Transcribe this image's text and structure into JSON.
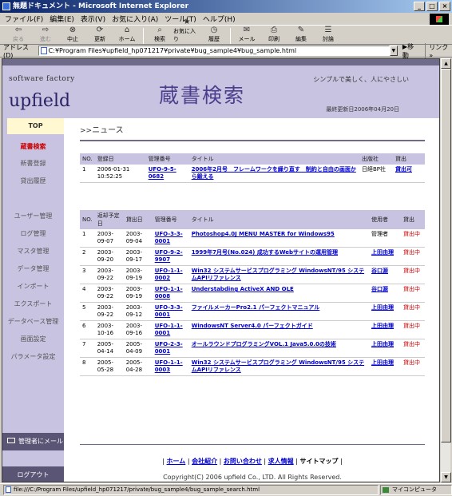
{
  "window": {
    "title": "無題ドキュメント - Microsoft Internet Explorer",
    "minimize": "_",
    "maximize": "□",
    "close": "×"
  },
  "menu": [
    "ファイル(F)",
    "編集(E)",
    "表示(V)",
    "お気に入り(A)",
    "ツール(T)",
    "ヘルプ(H)"
  ],
  "toolbar": {
    "back": "戻る",
    "forward": "進む",
    "stop": "中止",
    "refresh": "更新",
    "home": "ホーム",
    "search": "検索",
    "favorites": "お気に入り",
    "history": "履歴",
    "mail": "メール",
    "print": "印刷",
    "edit": "編集",
    "discuss": "討論"
  },
  "address": {
    "label": "アドレス(D)",
    "value": "C:¥Program Files¥upfield_hp071217¥private¥bug_sample4¥bug_sample.html",
    "go": "移動",
    "links": "リンク »"
  },
  "header": {
    "company": "software factory",
    "logo": "upfield",
    "title": "蔵書検索",
    "tagline": "シンプルで美しく、人にやさしい",
    "updated": "最終更新日2006年04月20日"
  },
  "sidebar": {
    "top": "TOP",
    "items": [
      "蔵書検索",
      "新書登録",
      "貸出履歴",
      "ユーザー管理",
      "ログ管理",
      "マスタ管理",
      "データ管理",
      "インポート",
      "エクスポート",
      "データベース管理",
      "画面設定",
      "パラメータ設定"
    ],
    "mail": "管理者にメール",
    "logout": "ログアウト"
  },
  "news": {
    "heading_arrows": ">>",
    "heading": "ニュース",
    "columns": [
      "NO.",
      "登録日",
      "管理番号",
      "タイトル",
      "出版社",
      "貸出"
    ],
    "rows": [
      {
        "no": "1",
        "date": "2006-01-31 10:52:25",
        "id": "UFO-9-5-0682",
        "title": "2006年2月号　フレームワークを繰り直す　制約と自由の画面から鍛える",
        "publisher": "日経BP社",
        "status": "貸出可"
      }
    ]
  },
  "loans": {
    "columns": [
      "NO.",
      "返却予定日",
      "貸出日",
      "管理番号",
      "タイトル",
      "使用者",
      "貸出"
    ],
    "rows": [
      {
        "no": "1",
        "due": "2003-09-07",
        "lent": "2003-09-04",
        "id": "UFO-3-3-0001",
        "title": "Photoshop4.0J MENU MASTER for Windows95",
        "user": "管理者",
        "user_link": false,
        "status": "貸出中"
      },
      {
        "no": "2",
        "due": "2003-09-20",
        "lent": "2003-09-17",
        "id": "UFO-9-2-9907",
        "title": "1999年7月号(No.024) 成功するWebサイトの運用管理",
        "user": "上田由理",
        "user_link": true,
        "status": "貸出中"
      },
      {
        "no": "3",
        "due": "2003-09-22",
        "lent": "2003-09-19",
        "id": "UFO-1-1-0002",
        "title": "Win32 システムサービスプログラミング WindowsNT/95 システムAPIリファレンス",
        "user": "谷口源",
        "user_link": true,
        "status": "貸出中"
      },
      {
        "no": "4",
        "due": "2003-09-22",
        "lent": "2003-09-19",
        "id": "UFO-1-1-0008",
        "title": "Understabding ActiveX AND OLE",
        "user": "谷口源",
        "user_link": true,
        "status": "貸出中"
      },
      {
        "no": "5",
        "due": "2003-09-22",
        "lent": "2003-09-12",
        "id": "UFO-3-3-0001",
        "title": "ファイルメーカーPro2.1 パーフェクトマニュアル",
        "user": "上田由理",
        "user_link": true,
        "status": "貸出中"
      },
      {
        "no": "6",
        "due": "2003-10-16",
        "lent": "2003-09-16",
        "id": "UFO-1-1-0001",
        "title": "WindowsNT Server4.0 パーフェクトガイド",
        "user": "上田由理",
        "user_link": true,
        "status": "貸出中"
      },
      {
        "no": "7",
        "due": "2005-04-14",
        "lent": "2005-04-09",
        "id": "UFO-2-3-0001",
        "title": "オールラウンドプログラミングVOL.1 Java5.0.0の技術",
        "user": "上田由理",
        "user_link": true,
        "status": "貸出中"
      },
      {
        "no": "8",
        "due": "2005-05-28",
        "lent": "2005-04-28",
        "id": "UFO-1-1-0003",
        "title": "Win32 システムサービスプログラミング WindowsNT/95 システムAPIリファレンス",
        "user": "上田由理",
        "user_link": true,
        "status": "貸出中"
      }
    ]
  },
  "footer": {
    "links": [
      "ホーム",
      "会社紹介",
      "お問い合わせ",
      "求人情報"
    ],
    "current": "サイトマップ",
    "copyright": "Copyright(C) 2006 upfield Co., LTD. All Rights Reserved."
  },
  "statusbar": {
    "text": "file:///C:/Program Files/upfield_hp071217/private/bug_sample4/bug_sample_search.html",
    "zone": "マイコンピュータ"
  }
}
